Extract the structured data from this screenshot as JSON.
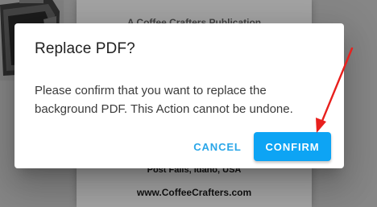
{
  "background_doc": {
    "top_line": "A Coffee Crafters Publication",
    "location_line": "Post Falls, Idaho, USA",
    "website_line": "www.CoffeeCrafters.com"
  },
  "dialog": {
    "title": "Replace PDF?",
    "message": "Please confirm that you want to replace the background PDF. This Action cannot be undone.",
    "cancel_label": "CANCEL",
    "confirm_label": "CONFIRM"
  },
  "annotation": {
    "type": "arrow",
    "target": "confirm-button",
    "color": "#e8201d"
  },
  "colors": {
    "accent": "#0da4f4",
    "cancel_text": "#2aa6e8",
    "overlay": "#868686"
  }
}
